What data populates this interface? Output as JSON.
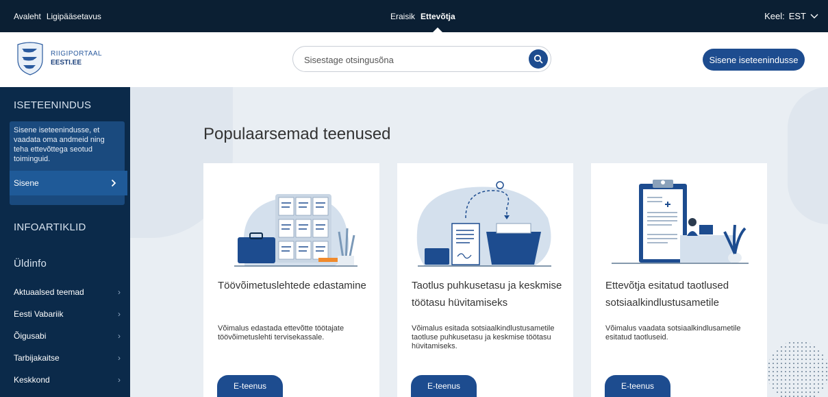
{
  "topbar": {
    "links": [
      "Avaleht",
      "Ligipääsetavus"
    ],
    "audience": [
      "Eraisik",
      "Ettevõtja"
    ],
    "lang_label": "Keel:",
    "lang_value": "EST"
  },
  "header": {
    "logo_line1": "RIIGIPORTAAL",
    "logo_line2": "EESTI.EE",
    "search_placeholder": "Sisestage otsingusõna",
    "login_label": "Sisene iseteenindusse"
  },
  "sidebar": {
    "section1": "ISETEENINDUS",
    "box_text": "Sisene iseteenindusse, et vaadata oma andmeid ning teha ettevõttega seotud toiminguid.",
    "enter_label": "Sisene",
    "section2": "INFOARTIKLID",
    "section3": "Üldinfo",
    "items": [
      "Aktuaalsed teemad",
      "Eesti Vabariik",
      "Õigusabi",
      "Tarbijakaitse",
      "Keskkond"
    ]
  },
  "main": {
    "title": "Populaarsemad teenused",
    "cards": [
      {
        "title": "Töövõimetuslehtede edastamine",
        "desc": "Võimalus edastada ettevõtte töötajate töövõimetuslehti tervisekassale.",
        "button": "E-teenus"
      },
      {
        "title": "Taotlus puhkusetasu ja keskmise töötasu hüvitamiseks",
        "desc": "Võimalus esitada sotsiaalkindlustusametile taotluse puhkusetasu ja keskmise töötasu hüvitamiseks.",
        "button": "E-teenus"
      },
      {
        "title": "Ettevõtja esitatud taotlused sotsiaalkindlustusametile",
        "desc": "Võimalus vaadata sotsiaalkindlusametile esitatud taotluseid.",
        "button": "E-teenus"
      }
    ]
  },
  "colors": {
    "topbar": "#0b1f33",
    "sidebar": "#0b2a4a",
    "accent": "#1d4c8f"
  },
  "icons": [
    "search-icon",
    "chevron-down-icon",
    "chevron-right-icon",
    "coat-of-arms-icon"
  ]
}
